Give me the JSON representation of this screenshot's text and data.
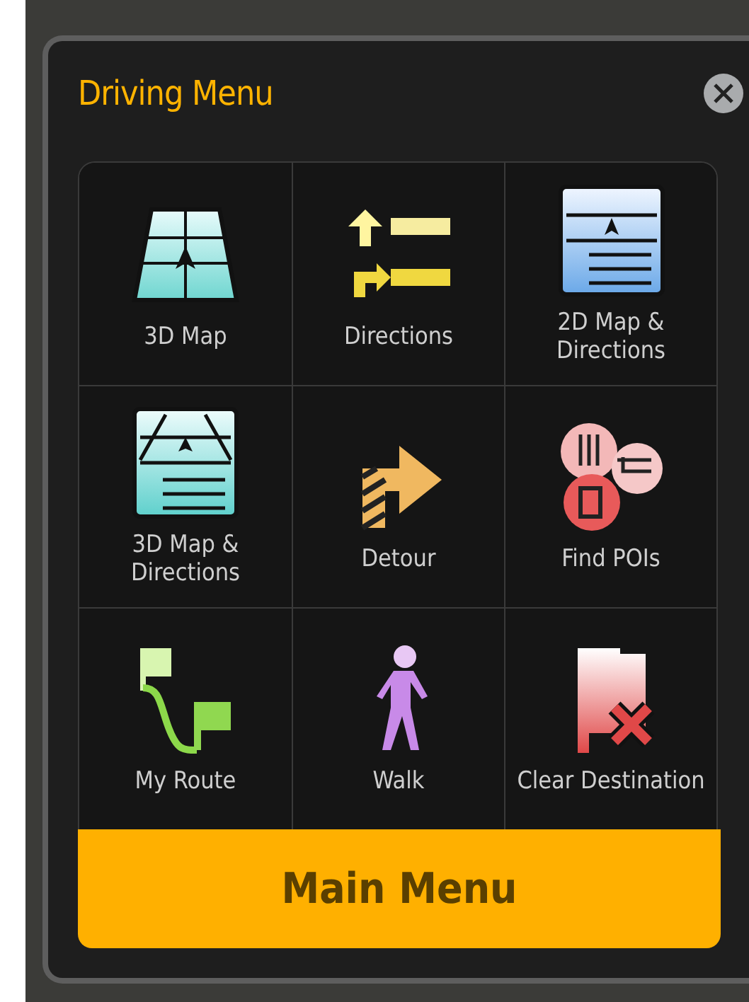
{
  "dialog": {
    "title": "Driving Menu"
  },
  "items": [
    {
      "kind": "map3d",
      "label": "3D Map"
    },
    {
      "kind": "directions",
      "label": "Directions"
    },
    {
      "kind": "map2d-directions",
      "label": "2D Map & Directions"
    },
    {
      "kind": "map3d-directions",
      "label": "3D Map & Directions"
    },
    {
      "kind": "detour",
      "label": "Detour"
    },
    {
      "kind": "poi",
      "label": "Find POIs"
    },
    {
      "kind": "route",
      "label": "My Route"
    },
    {
      "kind": "walk",
      "label": "Walk"
    },
    {
      "kind": "clear",
      "label": "Clear Destination"
    }
  ],
  "main_button": "Main Menu"
}
